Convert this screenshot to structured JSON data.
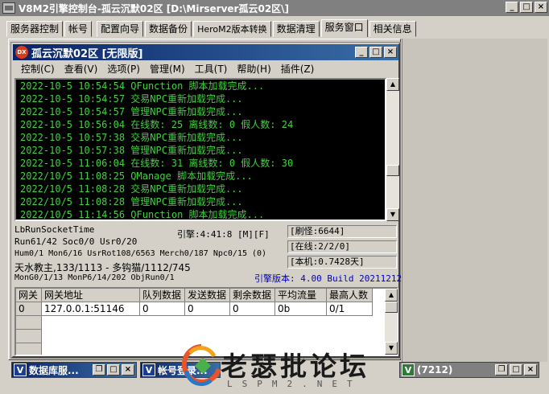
{
  "window": {
    "title": "V8M2引擎控制台-孤云沉默02区 [D:\\Mirserver孤云02区\\]"
  },
  "tabs": [
    {
      "label": "服务器控制"
    },
    {
      "label": "帐号"
    },
    {
      "label": "配置向导"
    },
    {
      "label": "数据备份"
    },
    {
      "label": "HeroM2版本转换"
    },
    {
      "label": "数据清理"
    },
    {
      "label": "服务窗口"
    },
    {
      "label": "相关信息"
    }
  ],
  "active_tab": "服务窗口",
  "m2": {
    "title": "孤云沉默02区 [无限版]",
    "icon_text": "DX",
    "menus": [
      {
        "label": "控制(C)"
      },
      {
        "label": "查看(V)"
      },
      {
        "label": "选项(P)"
      },
      {
        "label": "管理(M)"
      },
      {
        "label": "工具(T)"
      },
      {
        "label": "帮助(H)"
      },
      {
        "label": "插件(Z)"
      }
    ],
    "log": [
      "2022-10-5 10:54:54 QFunction 脚本加载完成...",
      "2022-10-5 10:54:57 交易NPC重新加载完成...",
      "2022-10-5 10:54:57 管理NPC重新加载完成...",
      "2022-10-5 10:56:04 在线数: 25 离线数: 0 假人数: 24",
      "2022-10-5 10:57:38 交易NPC重新加载完成...",
      "2022-10-5 10:57:38 管理NPC重新加载完成...",
      "2022-10-5 11:06:04 在线数: 31 离线数: 0 假人数: 30",
      "2022/10/5 11:08:25 QManage 脚本加载完成...",
      "2022/10/5 11:08:28 交易NPC重新加载完成...",
      "2022/10/5 11:08:28 管理NPC重新加载完成...",
      "2022/10/5 11:14:56 QFunction 脚本加载完成..."
    ],
    "status": {
      "line1": "LbRunSocketTime",
      "engine_time": "引擎:4:41:8 [M][F]",
      "line2": "Run61/42 Soc0/0 Usr0/20",
      "line3": "Hum0/1 Mon6/16 UsrRot108/6563 Merch0/187 Npc0/15 (0)",
      "line4": "天水教主,133/1113 - 多钩猫/1112/745",
      "line5": "MonG0/1/13 MonP6/14/202 ObjRun0/1",
      "refresh": "[刷怪:6644]",
      "online": "[在线:2/2/0]",
      "local": "[本机:0.7428天]",
      "version": "引擎版本: 4.00 Build 20211212"
    },
    "gateway_table": {
      "headers": [
        "网关",
        "网关地址",
        "队列数据",
        "发送数据",
        "剩余数据",
        "平均流量",
        "最高人数"
      ],
      "rows": [
        [
          "0",
          "127.0.0.1:51146",
          "0",
          "0",
          "0",
          "0b",
          "0/1"
        ]
      ]
    }
  },
  "minimized": [
    {
      "label": "数据库服..."
    },
    {
      "label": "帐号登录..."
    },
    {
      "label": "(7212)"
    }
  ],
  "watermark": {
    "text": "老瑟批论坛",
    "sub": "LSPM2.NET"
  },
  "colors": {
    "log_text": "#3cd23c",
    "version_text": "#0000c0",
    "title_active": "#0a246a"
  }
}
